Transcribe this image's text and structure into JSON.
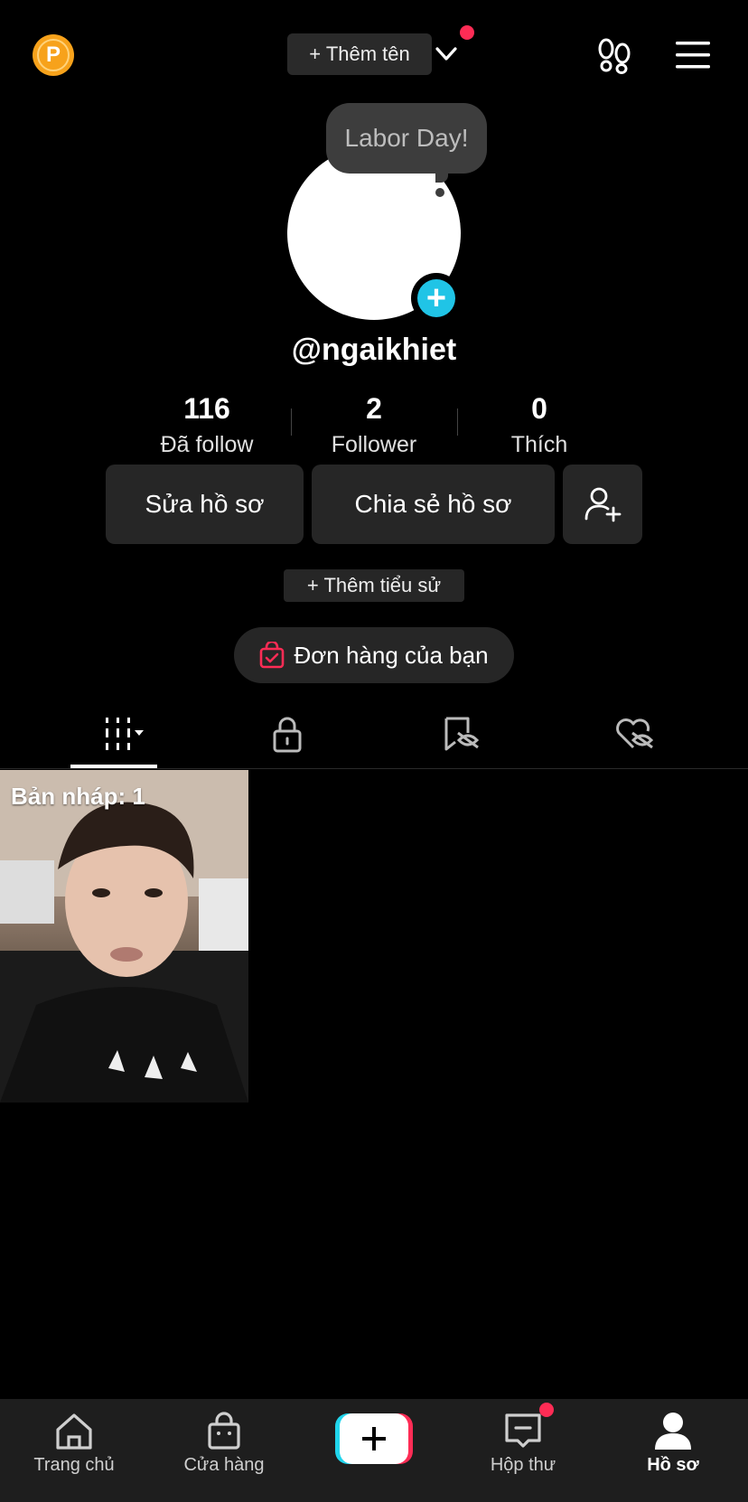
{
  "topbar": {
    "coin_letter": "P",
    "add_name_label": "+ Thêm tên"
  },
  "tooltip": {
    "text": "Labor Day!"
  },
  "profile": {
    "username": "@ngaikhiet",
    "stats": [
      {
        "value": "116",
        "label": "Đã follow"
      },
      {
        "value": "2",
        "label": "Follower"
      },
      {
        "value": "0",
        "label": "Thích"
      }
    ],
    "edit_label": "Sửa hồ sơ",
    "share_label": "Chia sẻ hồ sơ",
    "bio_label": "+ Thêm tiểu sử",
    "orders_label": "Đơn hàng của bạn"
  },
  "tabs": [
    {
      "icon": "grid-icon",
      "active": true
    },
    {
      "icon": "lock-icon",
      "active": false
    },
    {
      "icon": "saved-hidden-icon",
      "active": false
    },
    {
      "icon": "liked-hidden-icon",
      "active": false
    }
  ],
  "videos": [
    {
      "label": "Bản nháp: 1"
    }
  ],
  "nav": {
    "items": [
      {
        "label": "Trang chủ",
        "icon": "home-icon",
        "active": false
      },
      {
        "label": "Cửa hàng",
        "icon": "shop-icon",
        "active": false
      },
      {
        "label": "Hộp thư",
        "icon": "inbox-icon",
        "active": false
      },
      {
        "label": "Hồ sơ",
        "icon": "profile-icon",
        "active": true
      }
    ]
  },
  "colors": {
    "accent_red": "#fe2c55",
    "accent_cyan": "#20c4e6",
    "coin": "#f7a21b"
  }
}
